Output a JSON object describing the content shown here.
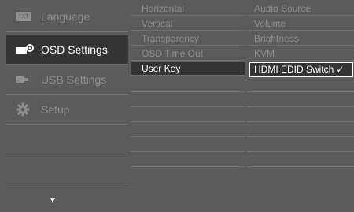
{
  "left_menu": {
    "items": [
      {
        "label": "Language",
        "icon": "language-icon",
        "selected": false
      },
      {
        "label": "OSD Settings",
        "icon": "osd-settings-icon",
        "selected": true
      },
      {
        "label": "USB Settings",
        "icon": "usb-icon",
        "selected": false
      },
      {
        "label": "Setup",
        "icon": "gear-icon",
        "selected": false
      }
    ],
    "language_icon_text": "TXT",
    "more_arrow": "▼"
  },
  "middle_menu": {
    "items": [
      {
        "label": "Horizontal"
      },
      {
        "label": "Vertical"
      },
      {
        "label": "Transparency"
      },
      {
        "label": "OSD Time Out"
      },
      {
        "label": "User Key",
        "active": true
      }
    ]
  },
  "right_menu": {
    "items": [
      {
        "label": "Audio Source"
      },
      {
        "label": "Volume"
      },
      {
        "label": "Brightness"
      },
      {
        "label": "KVM"
      },
      {
        "label": "HDMI EDID Switch",
        "selected": true,
        "check": "✓"
      }
    ]
  },
  "colors": {
    "panel_bg": "#5b5b5b",
    "selected_bg": "#343434",
    "dim_text": "#8e8e8e",
    "active_text": "#ffffff"
  }
}
